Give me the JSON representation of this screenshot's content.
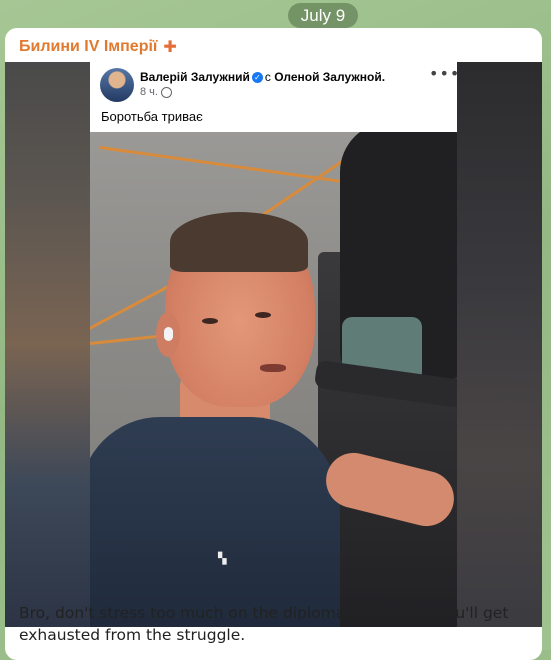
{
  "chat": {
    "date_label": "July 9"
  },
  "message": {
    "channel_name": "Билини IV Імперії",
    "channel_badge_icon": "cross-icon",
    "caption": "Bro, don't stress too much on the diplomatic front, or you'll get exhausted from the struggle."
  },
  "facebook_post": {
    "author": "Валерій Залужний",
    "verified_icon": "check-icon",
    "with_text": "с",
    "tagged": "Оленой Залужной.",
    "time": "8 ч.",
    "privacy_icon": "globe-icon",
    "more_icon": "more-dots-icon",
    "text": "Боротьба триває"
  },
  "colors": {
    "channel_name": "#e17a2f",
    "bubble_bg": "#ffffff",
    "date_pill_bg": "rgba(80,110,70,0.55)",
    "verified": "#1877f2"
  }
}
